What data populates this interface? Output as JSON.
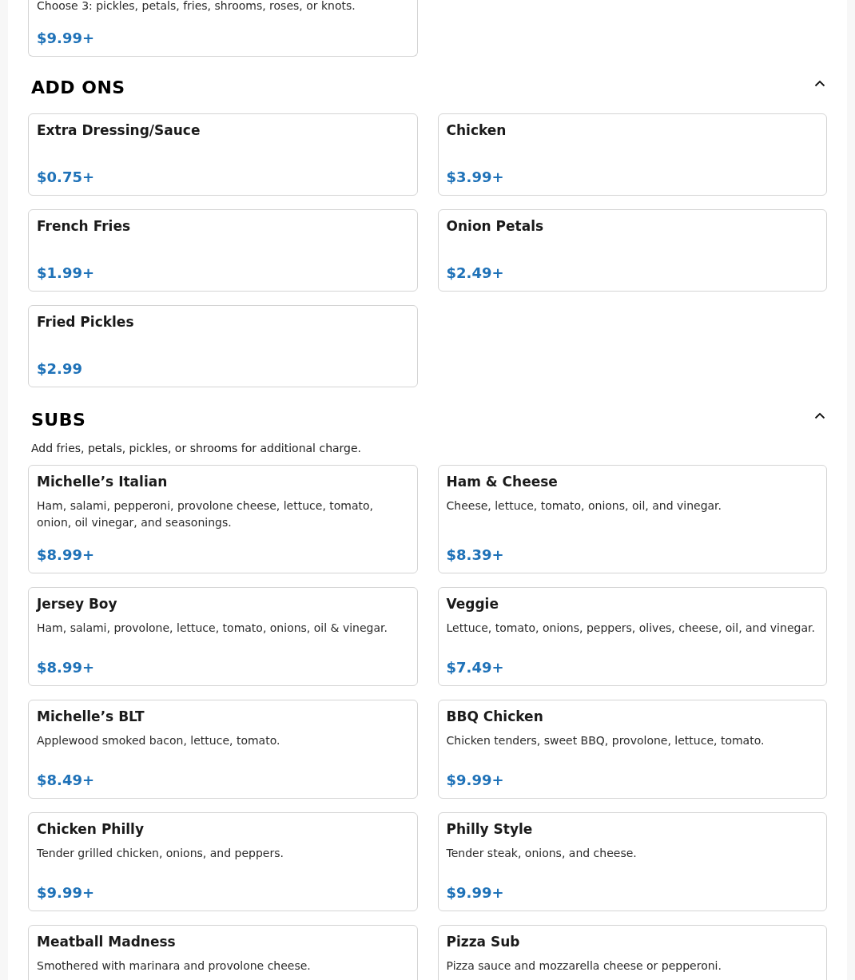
{
  "partial_item": {
    "description": "Choose 3: pickles, petals, fries, shrooms, roses, or knots.",
    "price": "$9.99+"
  },
  "sections": [
    {
      "title": "ADD ONS",
      "expanded": true,
      "items": [
        {
          "name": "Extra Dressing/Sauce",
          "price": "$0.75+"
        },
        {
          "name": "Chicken",
          "price": "$3.99+"
        },
        {
          "name": "French Fries",
          "price": "$1.99+"
        },
        {
          "name": "Onion Petals",
          "price": "$2.49+"
        },
        {
          "name": "Fried Pickles",
          "price": "$2.99"
        }
      ]
    },
    {
      "title": "SUBS",
      "expanded": true,
      "description": "Add fries, petals, pickles, or shrooms for additional charge.",
      "items": [
        {
          "name": "Michelle’s Italian",
          "description": "Ham, salami, pepperoni, provolone cheese, lettuce, tomato, onion, oil vinegar, and seasonings.",
          "price": "$8.99+"
        },
        {
          "name": "Ham & Cheese",
          "description": "Cheese, lettuce, tomato, onions, oil, and vinegar.",
          "price": "$8.39+"
        },
        {
          "name": "Jersey Boy",
          "description": "Ham, salami, provolone, lettuce, tomato, onions, oil & vinegar.",
          "price": "$8.99+"
        },
        {
          "name": "Veggie",
          "description": "Lettuce, tomato, onions, peppers, olives, cheese, oil, and vinegar.",
          "price": "$7.49+"
        },
        {
          "name": "Michelle’s BLT",
          "description": "Applewood smoked bacon, lettuce, tomato.",
          "price": "$8.49+"
        },
        {
          "name": "BBQ Chicken",
          "description": "Chicken tenders, sweet BBQ, provolone, lettuce, tomato.",
          "price": "$9.99+"
        },
        {
          "name": "Chicken Philly",
          "description": "Tender grilled chicken, onions, and peppers.",
          "price": "$9.99+"
        },
        {
          "name": "Philly Style",
          "description": "Tender steak, onions, and cheese.",
          "price": "$9.99+"
        },
        {
          "name": "Meatball Madness",
          "description": "Smothered with marinara and provolone cheese."
        },
        {
          "name": "Pizza Sub",
          "description": "Pizza sauce and mozzarella cheese or pepperoni."
        }
      ]
    }
  ]
}
